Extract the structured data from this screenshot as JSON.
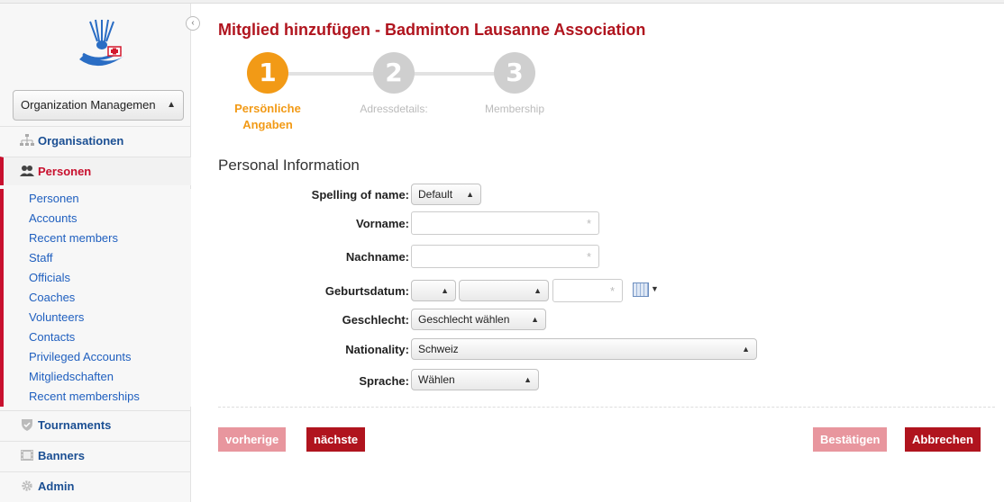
{
  "sidebar": {
    "org_select": "Organization Managemen",
    "sections": {
      "organisationen": "Organisationen",
      "personen": "Personen",
      "tournaments": "Tournaments",
      "banners": "Banners",
      "admin": "Admin"
    },
    "subitems": [
      "Personen",
      "Accounts",
      "Recent members",
      "Staff",
      "Officials",
      "Coaches",
      "Volunteers",
      "Contacts",
      "Privileged Accounts",
      "Mitgliedschaften",
      "Recent memberships"
    ]
  },
  "page": {
    "title": "Mitglied hinzufügen - Badminton Lausanne Association"
  },
  "wizard": {
    "steps": [
      {
        "number": "1",
        "label": "Persönliche Angaben"
      },
      {
        "number": "2",
        "label": "Adressdetails:"
      },
      {
        "number": "3",
        "label": "Membership"
      }
    ]
  },
  "form": {
    "section_title": "Personal Information",
    "spelling": {
      "label": "Spelling of name:",
      "value": "Default"
    },
    "vorname": {
      "label": "Vorname:",
      "value": ""
    },
    "nachname": {
      "label": "Nachname:",
      "value": ""
    },
    "geburtsdatum": {
      "label": "Geburtsdatum:",
      "day": "",
      "month": "",
      "year": ""
    },
    "geschlecht": {
      "label": "Geschlecht:",
      "value": "Geschlecht wählen"
    },
    "nationality": {
      "label": "Nationality:",
      "value": "Schweiz"
    },
    "sprache": {
      "label": "Sprache:",
      "value": "Wählen"
    },
    "required_mark": "*"
  },
  "buttons": {
    "prev": "vorherige",
    "next": "nächste",
    "confirm": "Bestätigen",
    "cancel": "Abbrechen"
  },
  "colors": {
    "accent": "#b0141e",
    "wizard_active": "#f29a16",
    "link": "#1f5fbf"
  }
}
